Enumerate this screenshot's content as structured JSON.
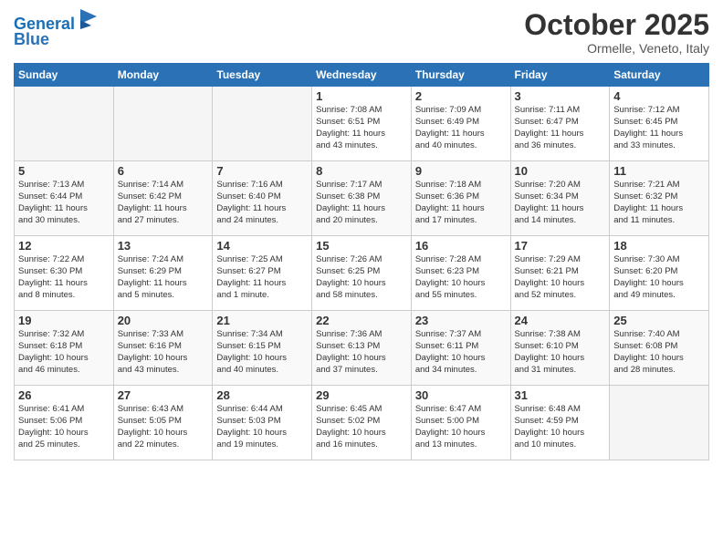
{
  "header": {
    "logo_line1": "General",
    "logo_line2": "Blue",
    "month": "October 2025",
    "location": "Ormelle, Veneto, Italy"
  },
  "weekdays": [
    "Sunday",
    "Monday",
    "Tuesday",
    "Wednesday",
    "Thursday",
    "Friday",
    "Saturday"
  ],
  "weeks": [
    [
      {
        "day": "",
        "info": ""
      },
      {
        "day": "",
        "info": ""
      },
      {
        "day": "",
        "info": ""
      },
      {
        "day": "1",
        "info": "Sunrise: 7:08 AM\nSunset: 6:51 PM\nDaylight: 11 hours\nand 43 minutes."
      },
      {
        "day": "2",
        "info": "Sunrise: 7:09 AM\nSunset: 6:49 PM\nDaylight: 11 hours\nand 40 minutes."
      },
      {
        "day": "3",
        "info": "Sunrise: 7:11 AM\nSunset: 6:47 PM\nDaylight: 11 hours\nand 36 minutes."
      },
      {
        "day": "4",
        "info": "Sunrise: 7:12 AM\nSunset: 6:45 PM\nDaylight: 11 hours\nand 33 minutes."
      }
    ],
    [
      {
        "day": "5",
        "info": "Sunrise: 7:13 AM\nSunset: 6:44 PM\nDaylight: 11 hours\nand 30 minutes."
      },
      {
        "day": "6",
        "info": "Sunrise: 7:14 AM\nSunset: 6:42 PM\nDaylight: 11 hours\nand 27 minutes."
      },
      {
        "day": "7",
        "info": "Sunrise: 7:16 AM\nSunset: 6:40 PM\nDaylight: 11 hours\nand 24 minutes."
      },
      {
        "day": "8",
        "info": "Sunrise: 7:17 AM\nSunset: 6:38 PM\nDaylight: 11 hours\nand 20 minutes."
      },
      {
        "day": "9",
        "info": "Sunrise: 7:18 AM\nSunset: 6:36 PM\nDaylight: 11 hours\nand 17 minutes."
      },
      {
        "day": "10",
        "info": "Sunrise: 7:20 AM\nSunset: 6:34 PM\nDaylight: 11 hours\nand 14 minutes."
      },
      {
        "day": "11",
        "info": "Sunrise: 7:21 AM\nSunset: 6:32 PM\nDaylight: 11 hours\nand 11 minutes."
      }
    ],
    [
      {
        "day": "12",
        "info": "Sunrise: 7:22 AM\nSunset: 6:30 PM\nDaylight: 11 hours\nand 8 minutes."
      },
      {
        "day": "13",
        "info": "Sunrise: 7:24 AM\nSunset: 6:29 PM\nDaylight: 11 hours\nand 5 minutes."
      },
      {
        "day": "14",
        "info": "Sunrise: 7:25 AM\nSunset: 6:27 PM\nDaylight: 11 hours\nand 1 minute."
      },
      {
        "day": "15",
        "info": "Sunrise: 7:26 AM\nSunset: 6:25 PM\nDaylight: 10 hours\nand 58 minutes."
      },
      {
        "day": "16",
        "info": "Sunrise: 7:28 AM\nSunset: 6:23 PM\nDaylight: 10 hours\nand 55 minutes."
      },
      {
        "day": "17",
        "info": "Sunrise: 7:29 AM\nSunset: 6:21 PM\nDaylight: 10 hours\nand 52 minutes."
      },
      {
        "day": "18",
        "info": "Sunrise: 7:30 AM\nSunset: 6:20 PM\nDaylight: 10 hours\nand 49 minutes."
      }
    ],
    [
      {
        "day": "19",
        "info": "Sunrise: 7:32 AM\nSunset: 6:18 PM\nDaylight: 10 hours\nand 46 minutes."
      },
      {
        "day": "20",
        "info": "Sunrise: 7:33 AM\nSunset: 6:16 PM\nDaylight: 10 hours\nand 43 minutes."
      },
      {
        "day": "21",
        "info": "Sunrise: 7:34 AM\nSunset: 6:15 PM\nDaylight: 10 hours\nand 40 minutes."
      },
      {
        "day": "22",
        "info": "Sunrise: 7:36 AM\nSunset: 6:13 PM\nDaylight: 10 hours\nand 37 minutes."
      },
      {
        "day": "23",
        "info": "Sunrise: 7:37 AM\nSunset: 6:11 PM\nDaylight: 10 hours\nand 34 minutes."
      },
      {
        "day": "24",
        "info": "Sunrise: 7:38 AM\nSunset: 6:10 PM\nDaylight: 10 hours\nand 31 minutes."
      },
      {
        "day": "25",
        "info": "Sunrise: 7:40 AM\nSunset: 6:08 PM\nDaylight: 10 hours\nand 28 minutes."
      }
    ],
    [
      {
        "day": "26",
        "info": "Sunrise: 6:41 AM\nSunset: 5:06 PM\nDaylight: 10 hours\nand 25 minutes."
      },
      {
        "day": "27",
        "info": "Sunrise: 6:43 AM\nSunset: 5:05 PM\nDaylight: 10 hours\nand 22 minutes."
      },
      {
        "day": "28",
        "info": "Sunrise: 6:44 AM\nSunset: 5:03 PM\nDaylight: 10 hours\nand 19 minutes."
      },
      {
        "day": "29",
        "info": "Sunrise: 6:45 AM\nSunset: 5:02 PM\nDaylight: 10 hours\nand 16 minutes."
      },
      {
        "day": "30",
        "info": "Sunrise: 6:47 AM\nSunset: 5:00 PM\nDaylight: 10 hours\nand 13 minutes."
      },
      {
        "day": "31",
        "info": "Sunrise: 6:48 AM\nSunset: 4:59 PM\nDaylight: 10 hours\nand 10 minutes."
      },
      {
        "day": "",
        "info": ""
      }
    ]
  ]
}
